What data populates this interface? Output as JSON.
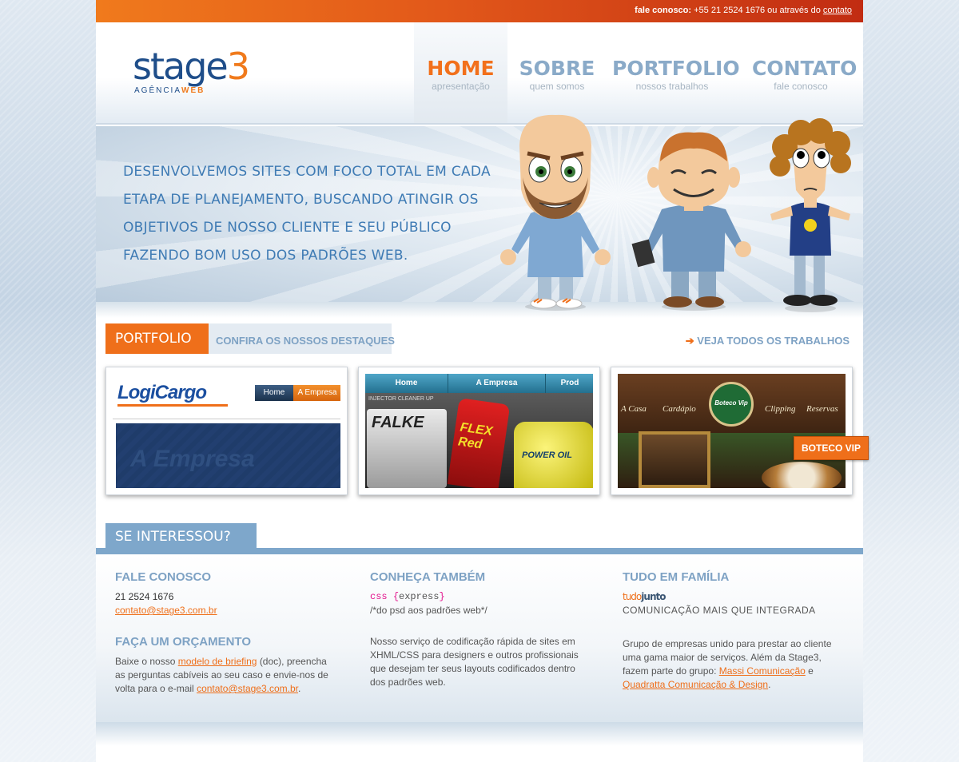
{
  "topbar": {
    "prefix": "fale conosco:",
    "phone_text": "+55 21 2524 1676 ou através do",
    "link": "contato"
  },
  "logo": {
    "word": "stage",
    "number": "3",
    "sub_a": "AGÊNCIA",
    "sub_b": "WEB"
  },
  "nav": [
    {
      "label": "HOME",
      "sub": "apresentação",
      "active": true
    },
    {
      "label": "SOBRE",
      "sub": "quem somos"
    },
    {
      "label": "PORTFOLIO",
      "sub": "nossos trabalhos"
    },
    {
      "label": "CONTATO",
      "sub": "fale conosco"
    }
  ],
  "hero": {
    "slogan": "Desenvolvemos sites com foco total em cada etapa de planejamento, buscando atingir os objetivos de nosso cliente e seu público fazendo bom uso dos padrões web."
  },
  "portfolio": {
    "tag": "PORTFOLIO",
    "desc": "CONFIRA OS NOSSOS DESTAQUES",
    "see_all": "VEJA TODOS OS TRABALHOS",
    "items": [
      {
        "logo": "LogiCargo",
        "nav": [
          "Home",
          "A Empresa"
        ],
        "banner": "A Empresa"
      },
      {
        "nav": [
          "Home",
          "A Empresa",
          "Prod"
        ],
        "products": [
          "FALKE",
          "FLEX Red",
          "POWER OIL"
        ],
        "top_text": "INJECTOR CLEANER UP"
      },
      {
        "menu": [
          "A Casa",
          "Cardápio",
          "Clipping",
          "Reservas"
        ],
        "badge": "Boteco Vip",
        "label": "BOTECO VIP"
      }
    ]
  },
  "interest": {
    "heading": "SE INTERESSOU?",
    "contact": {
      "title": "FALE CONOSCO",
      "phone": "21 2524 1676",
      "email": "contato@stage3.com.br"
    },
    "quote": {
      "title": "FAÇA UM ORÇAMENTO",
      "text_a": "Baixe o nosso",
      "link_a": "modelo de briefing",
      "text_b": "(doc), preencha as perguntas cabíveis ao seu caso e envie-nos de volta para o e-mail",
      "link_b": "contato@stage3.com.br",
      "text_c": "."
    },
    "also": {
      "title": "CONHEÇA TAMBÉM",
      "logo_css": "css",
      "logo_express": "express",
      "logo_sub": "/*do psd aos padrões web*/",
      "text": "Nosso serviço de codificação rápida de sites em XHML/CSS para designers e outros profissionais que desejam ter seus layouts codificados dentro dos padrões web."
    },
    "family": {
      "title": "TUDO EM FAMÍLIA",
      "logo_a": "tudo",
      "logo_b": "junto",
      "logo_sub": "COMUNICAÇÃO MAIS QUE INTEGRADA",
      "text_a": "Grupo de empresas unido para prestar ao cliente uma gama maior de serviços. Além da Stage3, fazem parte do grupo:",
      "link_a": "Massi Comunicação",
      "text_b": "e",
      "link_b": "Quadratta Comunicação & Design",
      "text_c": "."
    }
  },
  "colors": {
    "orange": "#ef6f1a",
    "blue_light": "#7ea7cb",
    "blue_dark": "#1f4e8a"
  }
}
